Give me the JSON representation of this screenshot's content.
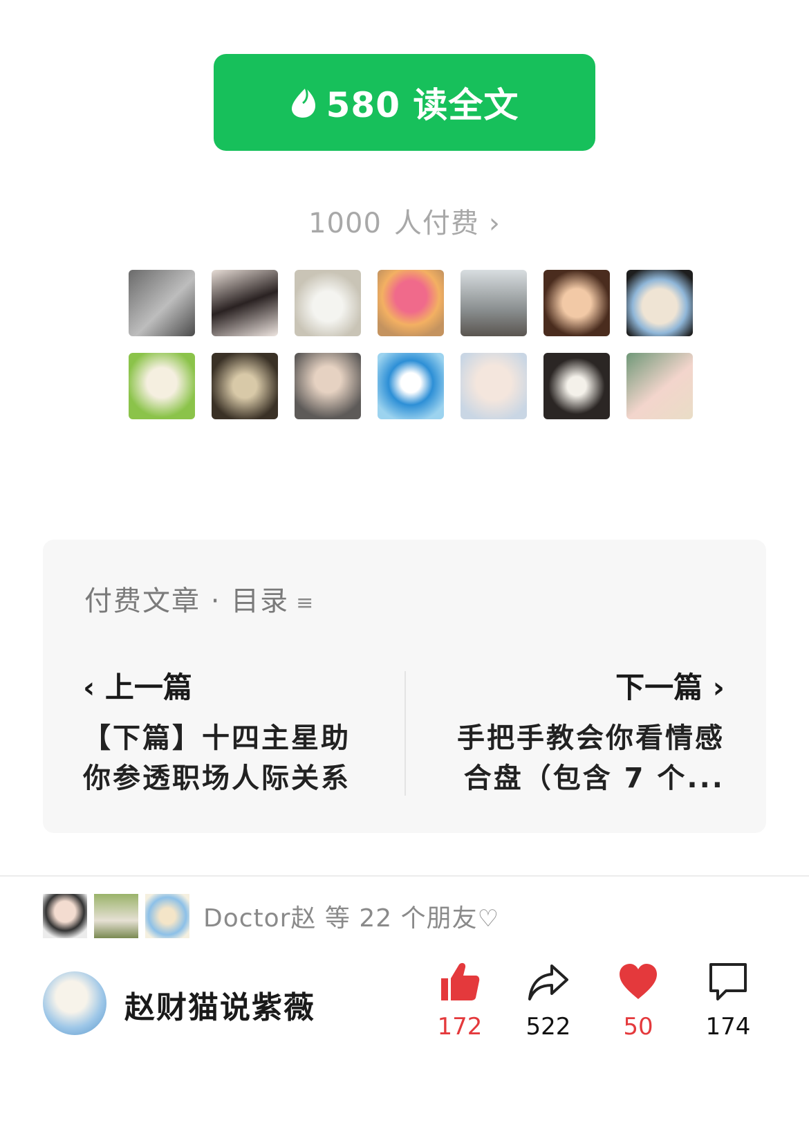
{
  "pay_button": {
    "label": "580 读全文",
    "icon": "coin-drop-icon",
    "color": "#17c05b"
  },
  "payers": {
    "count": "1000",
    "label": "人付费",
    "chevron": "›"
  },
  "catalog": {
    "title": "付费文章 · 目录",
    "menu_icon": "≡",
    "prev": {
      "label": "‹ 上一篇",
      "title": "【下篇】十四主星助你参透职场人际关系"
    },
    "next": {
      "label": "下一篇 ›",
      "title": "手把手教会你看情感合盘（包含 7 个..."
    }
  },
  "friends": {
    "text": "Doctor赵 等 22 个朋友",
    "heart": "♡"
  },
  "author": {
    "name": "赵财猫说紫薇"
  },
  "actions": {
    "like": {
      "count": "172",
      "icon": "thumbs-up-icon",
      "color": "#e4393c"
    },
    "share": {
      "count": "522",
      "icon": "share-arrow-icon"
    },
    "favorite": {
      "count": "50",
      "icon": "heart-icon",
      "color": "#e4393c"
    },
    "comment": {
      "count": "174",
      "icon": "comment-bubble-icon"
    }
  }
}
